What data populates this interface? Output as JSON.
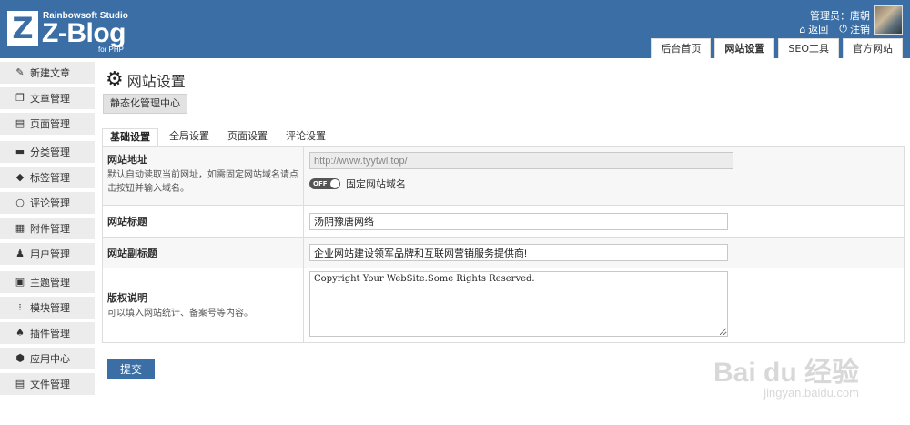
{
  "header": {
    "studio": "Rainbowsoft Studio",
    "brand": "Z-Blog",
    "php": "for PHP",
    "admin_label": "管理员：唐朝",
    "back_label": "返回",
    "logout_label": "注销",
    "tabs": [
      "后台首页",
      "网站设置",
      "SEO工具",
      "官方网站"
    ],
    "active_tab": "网站设置"
  },
  "sidebar": {
    "items": [
      {
        "label": "新建文章",
        "icon": "edit-icon"
      },
      {
        "label": "文章管理",
        "icon": "file-copy-icon"
      },
      {
        "label": "页面管理",
        "icon": "page-icon"
      },
      {
        "label": "分类管理",
        "icon": "folder-icon"
      },
      {
        "label": "标签管理",
        "icon": "tag-icon"
      },
      {
        "label": "评论管理",
        "icon": "comment-icon"
      },
      {
        "label": "附件管理",
        "icon": "attachment-icon"
      },
      {
        "label": "用户管理",
        "icon": "user-icon"
      },
      {
        "label": "主题管理",
        "icon": "theme-icon"
      },
      {
        "label": "模块管理",
        "icon": "module-icon"
      },
      {
        "label": "插件管理",
        "icon": "plugin-icon"
      },
      {
        "label": "应用中心",
        "icon": "app-center-icon"
      },
      {
        "label": "文件管理",
        "icon": "file-icon"
      }
    ]
  },
  "main": {
    "title": "网站设置",
    "static_button": "静态化管理中心",
    "tabs": [
      "基础设置",
      "全局设置",
      "页面设置",
      "评论设置"
    ],
    "active_tab": "基础设置",
    "fields": {
      "site_url": {
        "label": "网站地址",
        "desc": "默认自动读取当前网址，如需固定网站域名请点击按钮并输入域名。",
        "value": "http://www.tyytwl.top/",
        "toggle_text": "OFF",
        "toggle_label": "固定网站域名"
      },
      "site_title": {
        "label": "网站标题",
        "value": "汤阴豫唐网络"
      },
      "site_subtitle": {
        "label": "网站副标题",
        "value": "企业网站建设领军品牌和互联网营销服务提供商!"
      },
      "copyright": {
        "label": "版权说明",
        "desc": "可以填入网站统计、备案号等内容。",
        "value": "Copyright Your WebSite.Some Rights Reserved."
      }
    },
    "submit_label": "提交"
  },
  "watermark": {
    "brand": "Bai du 经验",
    "url": "jingyan.baidu.com"
  },
  "colors": {
    "header_bg": "#3a6ea5",
    "sidebar_bg": "#ececec",
    "submit_bg": "#3a6ea5"
  }
}
